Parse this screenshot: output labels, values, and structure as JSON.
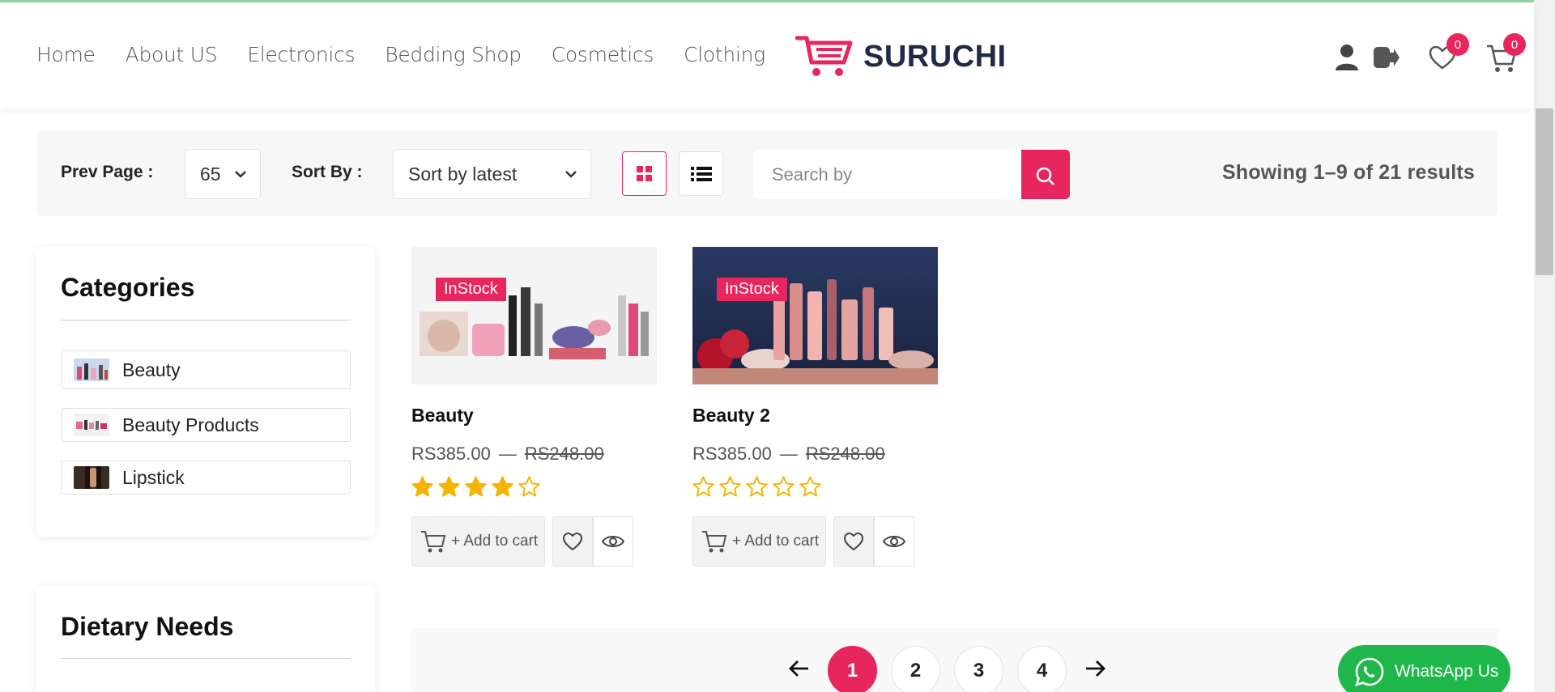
{
  "nav": {
    "items": [
      "Home",
      "About US",
      "Electronics",
      "Bedding Shop",
      "Cosmetics",
      "Clothing"
    ]
  },
  "brand": {
    "name": "SURUCHI",
    "accent": "#e8265e",
    "dark": "#1f2a44"
  },
  "header_icons": {
    "user": "user-icon",
    "logout": "logout-icon",
    "wishlist": "heart-icon",
    "wishlist_count": "0",
    "cart": "cart-icon",
    "cart_count": "0"
  },
  "toolbar": {
    "prev_page_label": "Prev Page :",
    "per_page_value": "65",
    "sort_label": "Sort By :",
    "sort_value": "Sort by latest",
    "search_placeholder": "Search by",
    "results_text": "Showing 1–9 of 21 results"
  },
  "sidebar": {
    "categories_title": "Categories",
    "categories": [
      {
        "label": "Beauty"
      },
      {
        "label": "Beauty Products"
      },
      {
        "label": "Lipstick"
      }
    ],
    "dietary_title": "Dietary Needs"
  },
  "products": [
    {
      "badge": "InStock",
      "name": "Beauty",
      "price": "RS385.00",
      "separator": "—",
      "old_price": "RS248.00",
      "rating": 4,
      "add_to_cart": "+ Add to cart"
    },
    {
      "badge": "InStock",
      "name": "Beauty 2",
      "price": "RS385.00",
      "separator": "—",
      "old_price": "RS248.00",
      "rating": 0,
      "add_to_cart": "+ Add to cart"
    }
  ],
  "pagination": {
    "pages": [
      "1",
      "2",
      "3",
      "4"
    ],
    "current": "1"
  },
  "whatsapp": {
    "label": "WhatsApp Us"
  }
}
